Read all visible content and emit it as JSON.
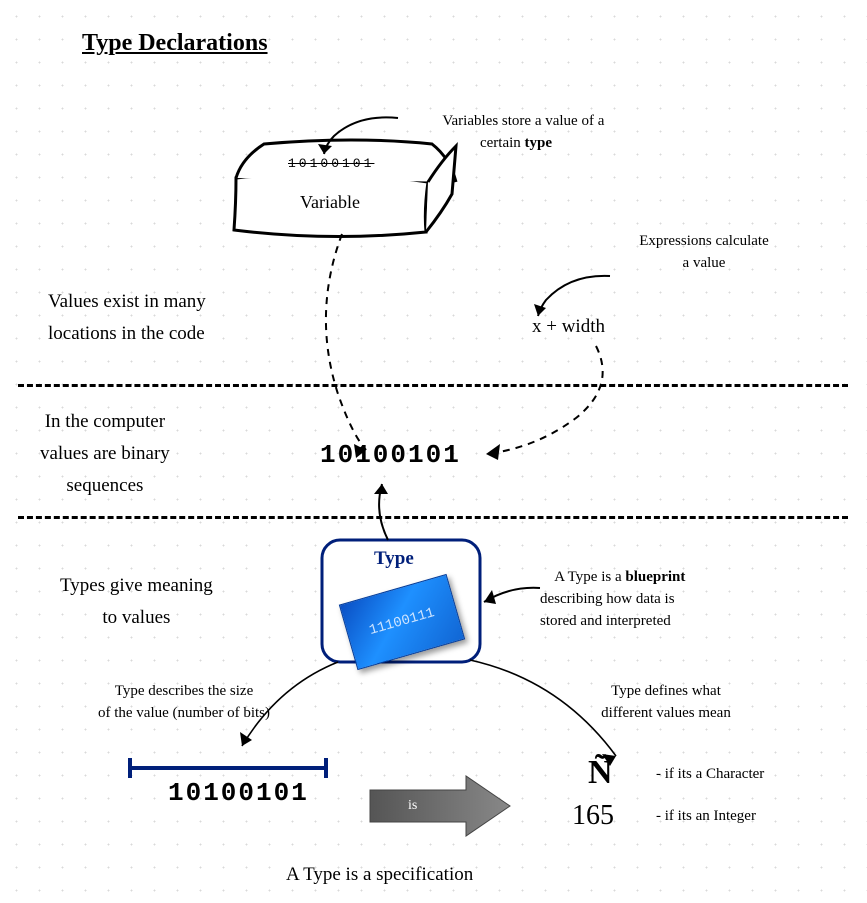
{
  "title": "Type Declarations",
  "annot_variable": "Variables store a value of a\ncertain ",
  "annot_variable_bold": "type",
  "binary_in_box": "10100101",
  "variable_label": "Variable",
  "annot_expression": "Expressions calculate\na value",
  "body_values_locations": "Values exist in many\nlocations in the code",
  "expression_text": "x + width",
  "body_binary": "In the computer\nvalues are binary\nsequences",
  "binary_center": "10100101",
  "body_types_meaning": "Types give meaning\nto values",
  "type_label": "Type",
  "blueprint_chip_text": "11100111",
  "annot_blueprint_a": "A Type is a ",
  "annot_blueprint_bold": "blueprint",
  "annot_blueprint_b": "\ndescribing how data is\nstored and interpreted",
  "annot_size": "Type describes the size\nof the value (number of bits)",
  "binary_bottom": "10100101",
  "annot_meaning": "Type defines what\ndifferent values mean",
  "char_glyph": "Ñ",
  "int_value": "165",
  "if_char": "- if its a Character",
  "if_int": "- if its an Integer",
  "is_label": "is",
  "footer": "A Type is a specification"
}
